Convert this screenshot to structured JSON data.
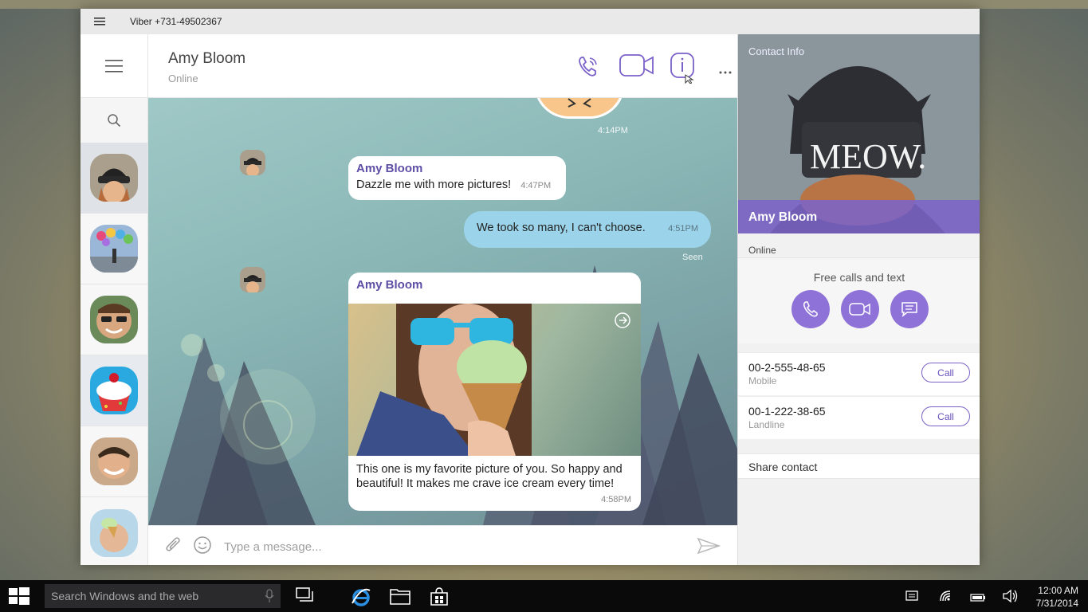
{
  "window": {
    "title": "Viber +731-49502367"
  },
  "chat_header": {
    "contact_name": "Amy Bloom",
    "status": "Online"
  },
  "messages": [
    {
      "time": "4:14PM"
    },
    {
      "sender": "Amy Bloom",
      "text": "Dazzle me with more pictures!",
      "time": "4:47PM"
    },
    {
      "text": "We took so many, I can't choose.",
      "time": "4:51PM",
      "receipt": "Seen"
    },
    {
      "sender": "Amy Bloom",
      "text": "This one is my favorite picture of you. So happy and beautiful! It makes me crave ice cream every time!",
      "time": "4:58PM"
    }
  ],
  "composer": {
    "placeholder": "Type a message..."
  },
  "contact_panel": {
    "heading": "Contact Info",
    "name": "Amy Bloom",
    "status": "Online",
    "photo_text": "MEOW.",
    "free_calls_label": "Free calls and text",
    "phones": [
      {
        "number": "00-2-555-48-65",
        "type": "Mobile",
        "button": "Call"
      },
      {
        "number": "00-1-222-38-65",
        "type": "Landline",
        "button": "Call"
      }
    ],
    "share": "Share contact"
  },
  "taskbar": {
    "search_placeholder": "Search Windows and the web",
    "time": "12:00 AM",
    "date": "7/31/2014"
  },
  "colors": {
    "accent": "#8f72d8",
    "bubble_mine": "#9bd4ea",
    "sender": "#5e4ea6"
  }
}
